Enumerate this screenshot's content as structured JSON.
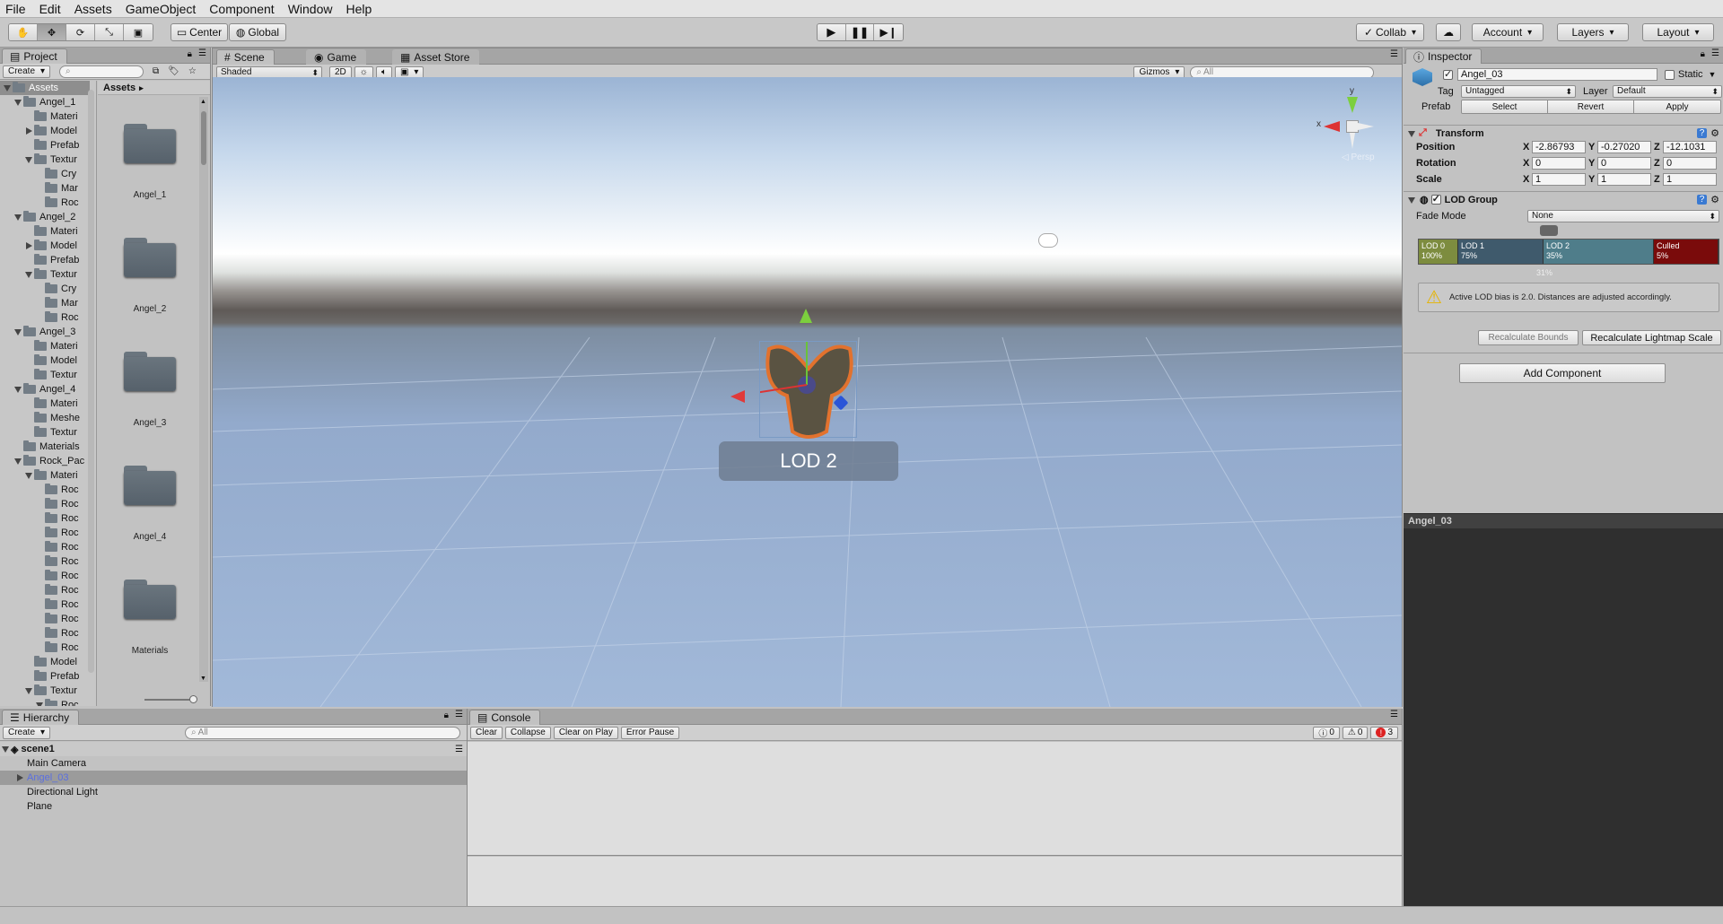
{
  "menu": [
    "File",
    "Edit",
    "Assets",
    "GameObject",
    "Component",
    "Window",
    "Help"
  ],
  "toolbar": {
    "pivot_label": "Center",
    "space_label": "Global",
    "collab_label": "Collab",
    "account_label": "Account",
    "layers_label": "Layers",
    "layout_label": "Layout"
  },
  "project": {
    "tab_label": "Project",
    "create_label": "Create",
    "assets_header": "Assets",
    "breadcrumb": "Assets",
    "tree": [
      {
        "label": "Assets",
        "depth": 0,
        "fold": "open",
        "selected": true
      },
      {
        "label": "Angel_1",
        "depth": 1,
        "fold": "open"
      },
      {
        "label": "Materi",
        "depth": 2,
        "fold": ""
      },
      {
        "label": "Model",
        "depth": 2,
        "fold": "closed"
      },
      {
        "label": "Prefab",
        "depth": 2,
        "fold": ""
      },
      {
        "label": "Textur",
        "depth": 2,
        "fold": "open"
      },
      {
        "label": "Cry",
        "depth": 3,
        "fold": ""
      },
      {
        "label": "Mar",
        "depth": 3,
        "fold": ""
      },
      {
        "label": "Roc",
        "depth": 3,
        "fold": ""
      },
      {
        "label": "Angel_2",
        "depth": 1,
        "fold": "open"
      },
      {
        "label": "Materi",
        "depth": 2,
        "fold": ""
      },
      {
        "label": "Model",
        "depth": 2,
        "fold": "closed"
      },
      {
        "label": "Prefab",
        "depth": 2,
        "fold": ""
      },
      {
        "label": "Textur",
        "depth": 2,
        "fold": "open"
      },
      {
        "label": "Cry",
        "depth": 3,
        "fold": ""
      },
      {
        "label": "Mar",
        "depth": 3,
        "fold": ""
      },
      {
        "label": "Roc",
        "depth": 3,
        "fold": ""
      },
      {
        "label": "Angel_3",
        "depth": 1,
        "fold": "open"
      },
      {
        "label": "Materi",
        "depth": 2,
        "fold": ""
      },
      {
        "label": "Model",
        "depth": 2,
        "fold": ""
      },
      {
        "label": "Textur",
        "depth": 2,
        "fold": ""
      },
      {
        "label": "Angel_4",
        "depth": 1,
        "fold": "open"
      },
      {
        "label": "Materi",
        "depth": 2,
        "fold": ""
      },
      {
        "label": "Meshe",
        "depth": 2,
        "fold": ""
      },
      {
        "label": "Textur",
        "depth": 2,
        "fold": ""
      },
      {
        "label": "Materials",
        "depth": 1,
        "fold": ""
      },
      {
        "label": "Rock_Pac",
        "depth": 1,
        "fold": "open"
      },
      {
        "label": "Materi",
        "depth": 2,
        "fold": "open"
      },
      {
        "label": "Roc",
        "depth": 3,
        "fold": ""
      },
      {
        "label": "Roc",
        "depth": 3,
        "fold": ""
      },
      {
        "label": "Roc",
        "depth": 3,
        "fold": ""
      },
      {
        "label": "Roc",
        "depth": 3,
        "fold": ""
      },
      {
        "label": "Roc",
        "depth": 3,
        "fold": ""
      },
      {
        "label": "Roc",
        "depth": 3,
        "fold": ""
      },
      {
        "label": "Roc",
        "depth": 3,
        "fold": ""
      },
      {
        "label": "Roc",
        "depth": 3,
        "fold": ""
      },
      {
        "label": "Roc",
        "depth": 3,
        "fold": ""
      },
      {
        "label": "Roc",
        "depth": 3,
        "fold": ""
      },
      {
        "label": "Roc",
        "depth": 3,
        "fold": ""
      },
      {
        "label": "Roc",
        "depth": 3,
        "fold": ""
      },
      {
        "label": "Model",
        "depth": 2,
        "fold": ""
      },
      {
        "label": "Prefab",
        "depth": 2,
        "fold": ""
      },
      {
        "label": "Textur",
        "depth": 2,
        "fold": "open"
      },
      {
        "label": "Roc",
        "depth": 3,
        "fold": "open"
      }
    ],
    "folders": [
      "Angel_1",
      "Angel_2",
      "Angel_3",
      "Angel_4",
      "Materials"
    ]
  },
  "scene": {
    "tabs": [
      "Scene",
      "Game",
      "Asset Store"
    ],
    "shading_mode": "Shaded",
    "mode_2d": "2D",
    "gizmos_label": "Gizmos",
    "search_placeholder": "All",
    "lod_label": "LOD 2",
    "persp_label": "Persp",
    "axis_x": "x",
    "axis_y": "y"
  },
  "hierarchy": {
    "tab_label": "Hierarchy",
    "create_label": "Create",
    "search_placeholder": "All",
    "scene_name": "scene1",
    "items": [
      "Main Camera",
      "Angel_03",
      "Directional Light",
      "Plane"
    ],
    "selected_index": 1
  },
  "console": {
    "tab_label": "Console",
    "buttons": [
      "Clear",
      "Collapse",
      "Clear on Play",
      "Error Pause"
    ],
    "info_count": "0",
    "warn_count": "0",
    "error_count": "3"
  },
  "inspector": {
    "tab_label": "Inspector",
    "object_name": "Angel_03",
    "static_label": "Static",
    "tag_label": "Tag",
    "tag_value": "Untagged",
    "layer_label": "Layer",
    "layer_value": "Default",
    "prefab_label": "Prefab",
    "prefab_buttons": [
      "Select",
      "Revert",
      "Apply"
    ],
    "transform": {
      "title": "Transform",
      "rows": [
        {
          "label": "Position",
          "x": "-2.86793",
          "y": "-0.27020",
          "z": "-12.1031"
        },
        {
          "label": "Rotation",
          "x": "0",
          "y": "0",
          "z": "0"
        },
        {
          "label": "Scale",
          "x": "1",
          "y": "1",
          "z": "1"
        }
      ]
    },
    "lod_group": {
      "title": "LOD Group",
      "fade_mode_label": "Fade Mode",
      "fade_mode_value": "None",
      "levels": [
        {
          "name": "LOD 0",
          "pct": "100%",
          "color": "#7d8c3f"
        },
        {
          "name": "LOD 1",
          "pct": "75%",
          "color": "#3f5a6c"
        },
        {
          "name": "LOD 2",
          "pct": "35%",
          "color": "#4f7d8a"
        },
        {
          "name": "Culled",
          "pct": "5%",
          "color": "#7a0b0b"
        }
      ],
      "camera_pct": "31%",
      "warning": "Active LOD bias is 2.0. Distances are adjusted accordingly.",
      "recalc_bounds": "Recalculate Bounds",
      "recalc_lightmap": "Recalculate Lightmap Scale"
    },
    "add_component": "Add Component",
    "preview_title": "Angel_03"
  }
}
